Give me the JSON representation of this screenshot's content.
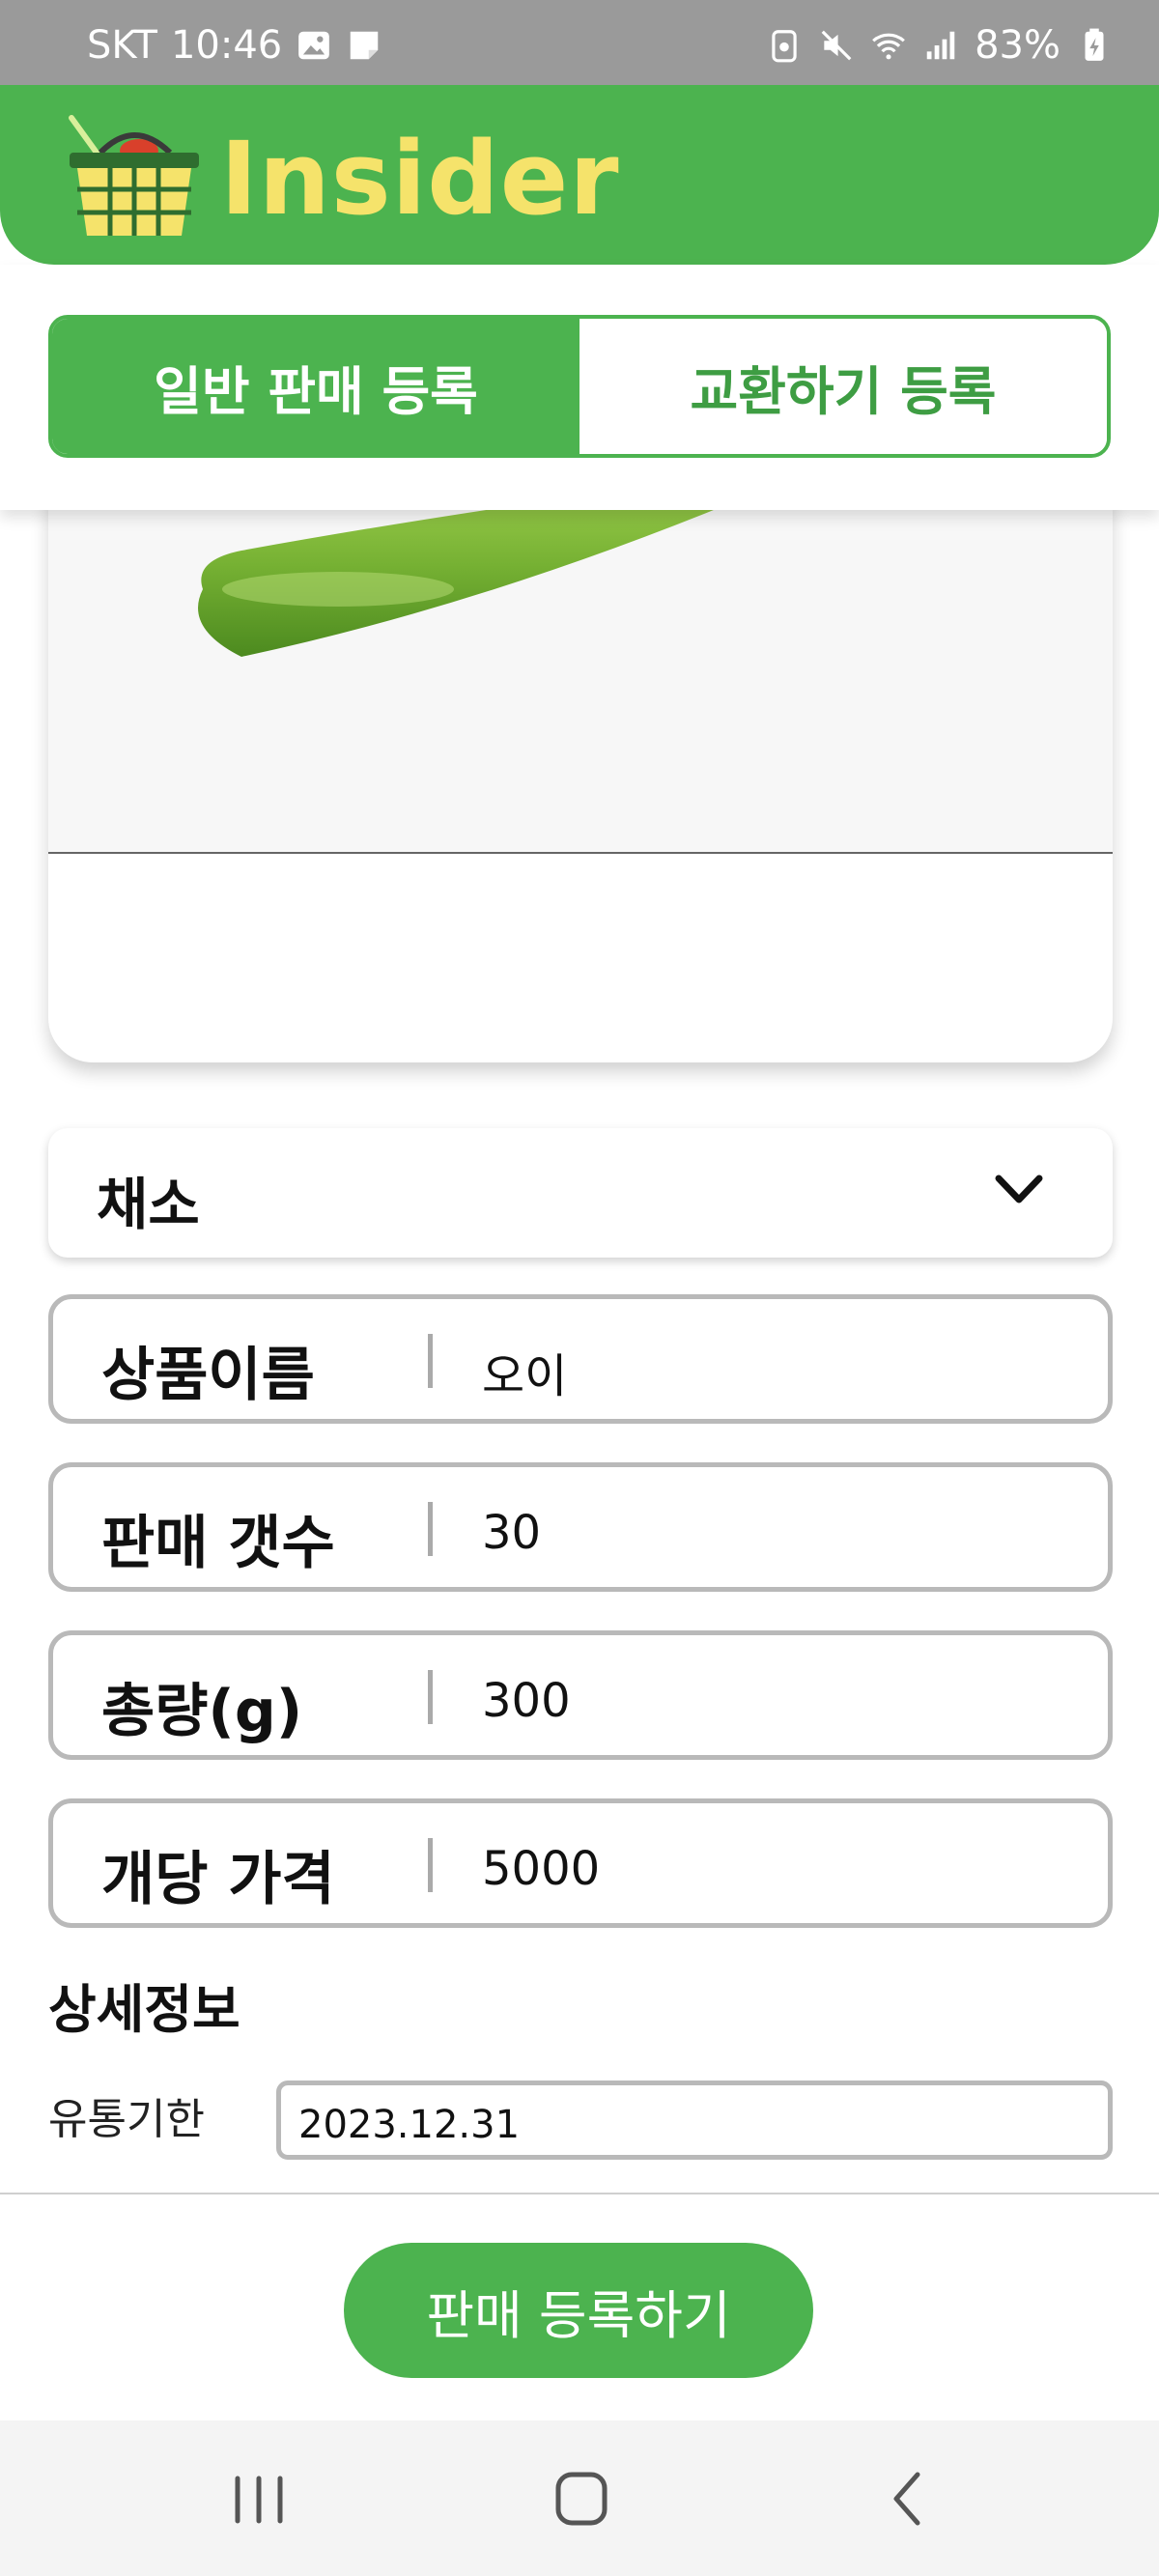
{
  "status_bar": {
    "carrier": "SKT",
    "time": "10:46",
    "battery": "83%"
  },
  "header": {
    "brand": "Insider"
  },
  "tabs": [
    {
      "label": "일반 판매 등록",
      "active": true
    },
    {
      "label": "교환하기 등록",
      "active": false
    }
  ],
  "category": {
    "selected": "채소"
  },
  "fields": [
    {
      "label": "상품이름",
      "value": "오이"
    },
    {
      "label": "판매 갯수",
      "value": "30"
    },
    {
      "label": "총량(g)",
      "value": "300"
    },
    {
      "label": "개당 가격",
      "value": "5000"
    }
  ],
  "details": {
    "title": "상세정보",
    "expiry_label": "유통기한",
    "expiry_value": "2023.12.31"
  },
  "submit_label": "판매 등록하기",
  "colors": {
    "accent": "#4cb34f",
    "brand_text": "#f5e36b",
    "border": "#b9b9b9"
  },
  "icons": [
    "gallery-icon",
    "note-icon",
    "lock-icon",
    "mute-icon",
    "wifi-icon",
    "signal-icon",
    "battery-icon",
    "basket-logo",
    "chevron-down-icon",
    "recent-apps-icon",
    "home-icon",
    "back-icon"
  ]
}
